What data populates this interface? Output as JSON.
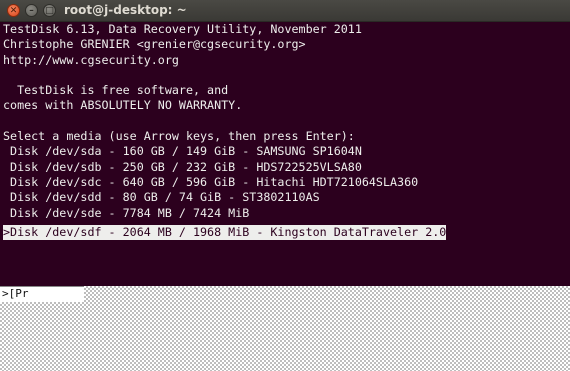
{
  "window": {
    "title": "root@j-desktop: ~",
    "close_glyph": "✕",
    "min_glyph": "–",
    "max_glyph": "□"
  },
  "terminal": {
    "lines": [
      "TestDisk 6.13, Data Recovery Utility, November 2011",
      "Christophe GRENIER <grenier@cgsecurity.org>",
      "http://www.cgsecurity.org",
      "",
      "  TestDisk is free software, and",
      "comes with ABSOLUTELY NO WARRANTY.",
      "",
      "Select a media (use Arrow keys, then press Enter):",
      " Disk /dev/sda - 160 GB / 149 GiB - SAMSUNG SP1604N",
      " Disk /dev/sdb - 250 GB / 232 GiB - HDS722525VLSA80",
      " Disk /dev/sdc - 640 GB / 596 GiB - Hitachi HDT721064SLA360",
      " Disk /dev/sdd - 80 GB / 74 GiB - ST3802110AS",
      " Disk /dev/sde - 7784 MB / 7424 MiB",
      ">Disk /dev/sdf - 2064 MB / 1968 MiB - Kingston DataTraveler 2.0"
    ],
    "selected_index": 13,
    "menu_prompt": ">[Pr"
  },
  "colors": {
    "terminal_bg": "#2c001e",
    "terminal_fg": "#eeeeec",
    "titlebar": "#3c3b37",
    "close_button": "#df4a16"
  }
}
